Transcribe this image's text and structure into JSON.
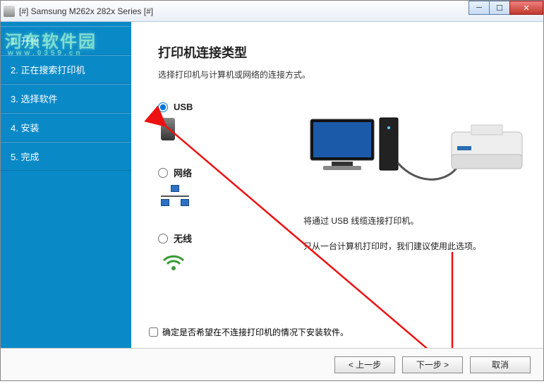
{
  "window": {
    "title": "[#] Samsung M262x 282x Series [#]"
  },
  "watermark": {
    "line1": "河东软件园",
    "line2": "www.0359.cn"
  },
  "sidebar": {
    "items": [
      {
        "label": "1. 开始"
      },
      {
        "label": "2. 正在搜索打印机"
      },
      {
        "label": "3. 选择软件"
      },
      {
        "label": "4. 安装"
      },
      {
        "label": "5. 完成"
      }
    ]
  },
  "content": {
    "heading": "打印机连接类型",
    "subtext": "选择打印机与计算机或网络的连接方式。"
  },
  "options": {
    "usb": {
      "label": "USB",
      "selected": true
    },
    "network": {
      "label": "网络",
      "selected": false
    },
    "wireless": {
      "label": "无线",
      "selected": false
    }
  },
  "description": {
    "line1": "将通过 USB 线缆连接打印机。",
    "line2": "只从一台计算机打印时，我们建议使用此选项。"
  },
  "checkbox": {
    "label": "确定是否希望在不连接打印机的情况下安装软件。",
    "checked": false
  },
  "buttons": {
    "back": "< 上一步",
    "next": "下一步 >",
    "cancel": "取消"
  }
}
